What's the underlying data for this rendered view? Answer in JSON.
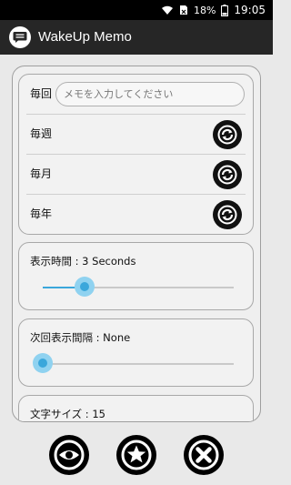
{
  "status_bar": {
    "battery": "18%",
    "time": "19:05"
  },
  "app": {
    "title": "WakeUp Memo"
  },
  "repeat": {
    "rows": [
      {
        "label": "毎回",
        "placeholder": "メモを入力してください"
      },
      {
        "label": "毎週"
      },
      {
        "label": "毎月"
      },
      {
        "label": "毎年"
      }
    ]
  },
  "display_time": {
    "label": "表示時間 : 3 Seconds",
    "value_fraction": 0.22
  },
  "next_interval": {
    "label": "次回表示間隔 : None",
    "value_fraction": 0.0
  },
  "font_size": {
    "label": "文字サイズ : 15"
  },
  "colors": {
    "accent": "#3aa7db",
    "appbar": "#262626",
    "background": "#e9e9e9"
  },
  "icons": {
    "status": [
      "wifi-icon",
      "sim-icon",
      "battery-icon"
    ],
    "app_logo": "chat-bubble-icon",
    "repeat_button": "sync-icon",
    "bottom": [
      "eye-icon",
      "star-icon",
      "close-icon"
    ]
  }
}
